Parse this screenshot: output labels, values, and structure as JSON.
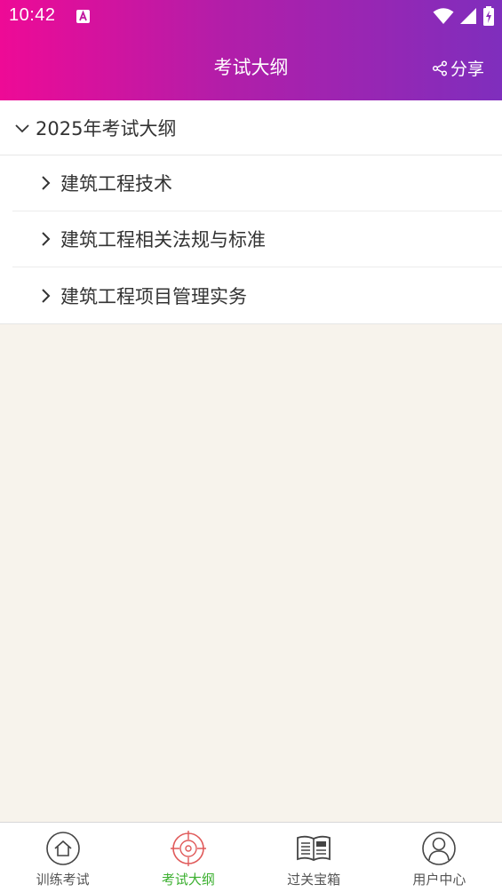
{
  "status_bar": {
    "time": "10:42",
    "icons": [
      "notification-a-icon",
      "wifi-icon",
      "signal-icon",
      "battery-charging-icon"
    ]
  },
  "header": {
    "title": "考试大纲",
    "share_label": "分享"
  },
  "outline": {
    "section_title": "2025年考试大纲",
    "items": [
      {
        "label": "建筑工程技术"
      },
      {
        "label": "建筑工程相关法规与标准"
      },
      {
        "label": "建筑工程项目管理实务"
      }
    ]
  },
  "bottom_nav": {
    "items": [
      {
        "label": "训练考试",
        "icon": "home-icon"
      },
      {
        "label": "考试大纲",
        "icon": "target-icon",
        "active": true
      },
      {
        "label": "过关宝箱",
        "icon": "news-book-icon"
      },
      {
        "label": "用户中心",
        "icon": "user-icon"
      }
    ]
  },
  "colors": {
    "header_gradient_start": "#ee0a96",
    "header_gradient_end": "#7f2ebd",
    "active_nav": "#3cb030",
    "active_nav_icon": "#e05a5a",
    "page_background": "#f7f3ec"
  }
}
